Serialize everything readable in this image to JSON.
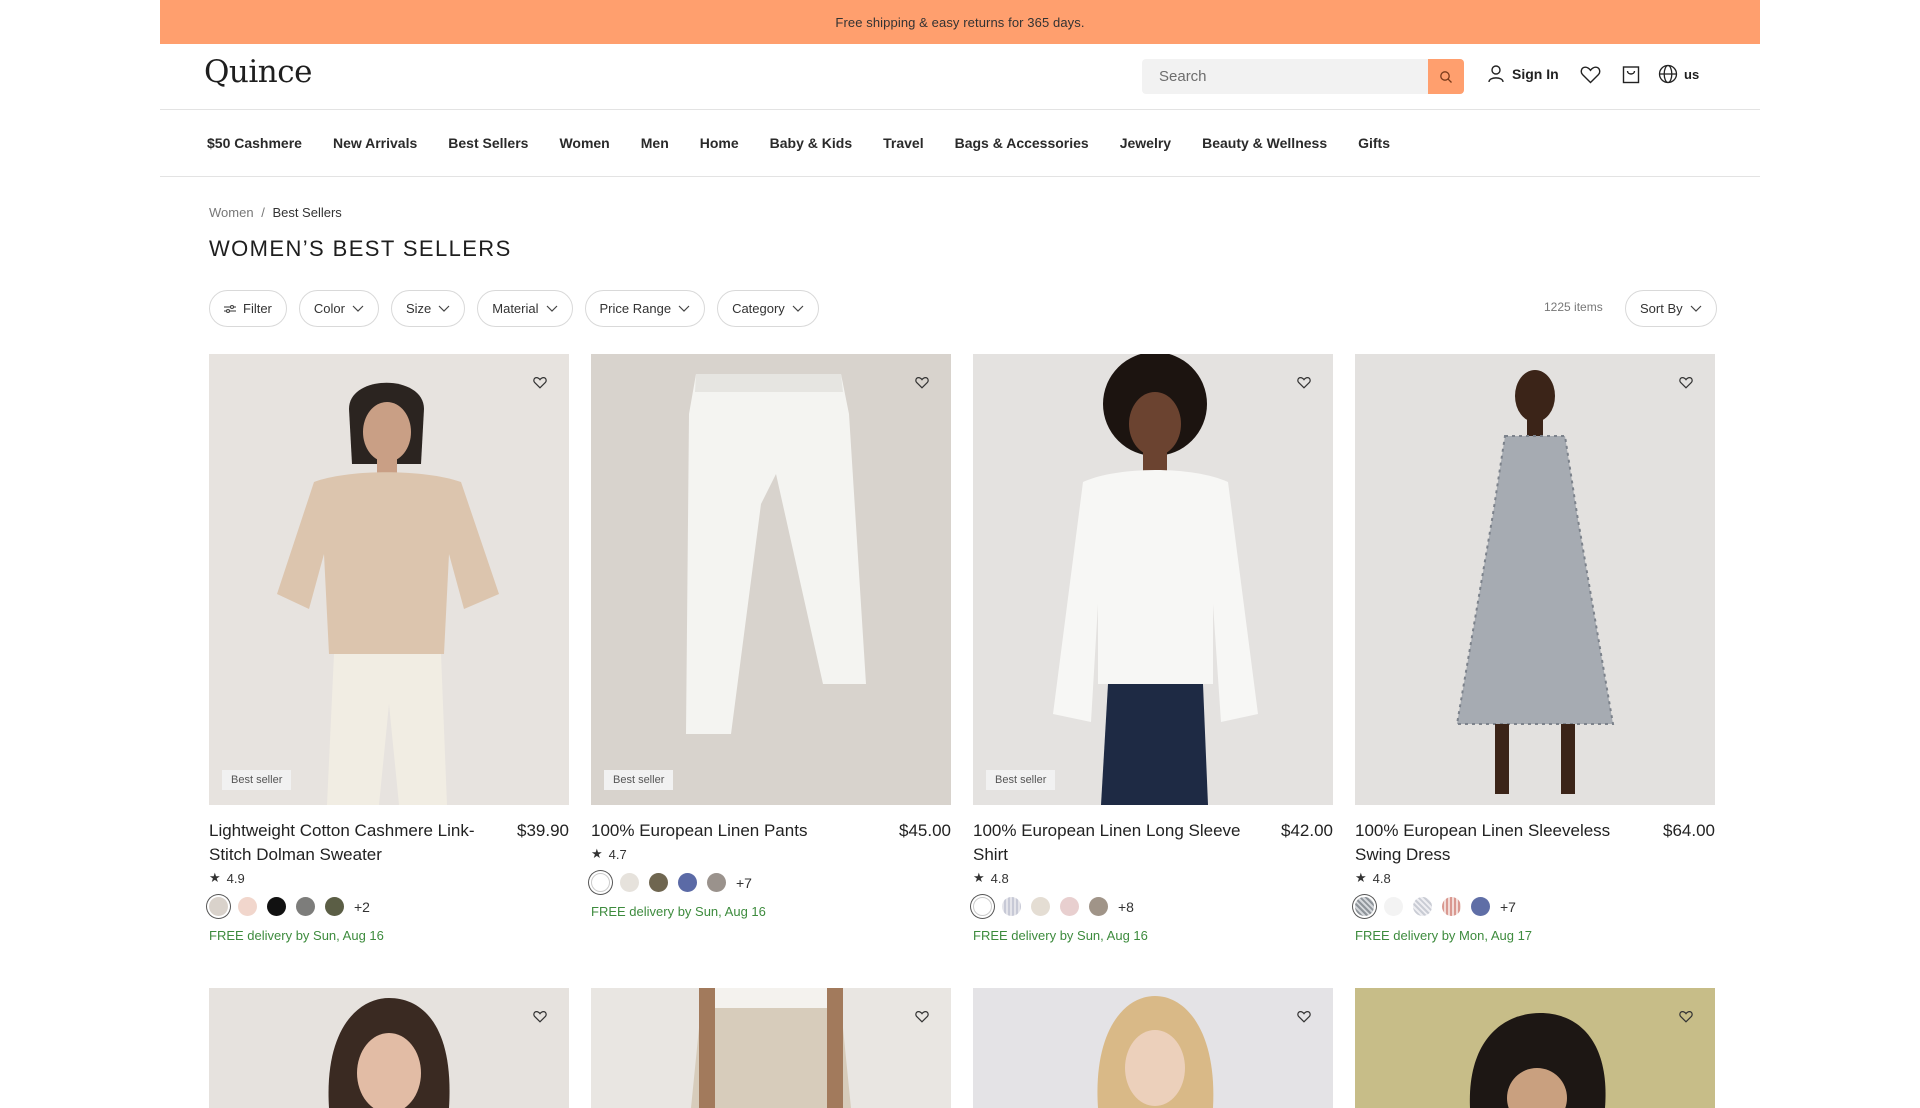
{
  "announcement": "Free shipping & easy returns for 365 days.",
  "header": {
    "logo": "Quince",
    "search_placeholder": "Search",
    "sign_in": "Sign In",
    "locale": "us"
  },
  "nav": [
    "$50 Cashmere",
    "New Arrivals",
    "Best Sellers",
    "Women",
    "Men",
    "Home",
    "Baby & Kids",
    "Travel",
    "Bags & Accessories",
    "Jewelry",
    "Beauty & Wellness",
    "Gifts"
  ],
  "breadcrumb": {
    "parent": "Women",
    "separator": "/",
    "current": "Best Sellers"
  },
  "page_title": "WOMEN’S BEST SELLERS",
  "filters": [
    "Filter",
    "Color",
    "Size",
    "Material",
    "Price Range",
    "Category"
  ],
  "item_count": "1225 items",
  "sort_label": "Sort By",
  "products": [
    {
      "name": "Lightweight Cotton Cashmere Link-Stitch Dolman Sweater",
      "price": "$39.90",
      "rating": "4.9",
      "badge": "Best seller",
      "swatches": [
        "#d9d2cb",
        "#f1d6cc",
        "#111111",
        "#7d7d7b",
        "#5b5e45"
      ],
      "more": "+2",
      "delivery": "FREE delivery by Sun, Aug 16",
      "image_bg": "#e7e3df"
    },
    {
      "name": "100% European Linen Pants",
      "price": "$45.00",
      "rating": "4.7",
      "badge": "Best seller",
      "swatches": [
        "#ffffff",
        "#e6e2dc",
        "#6f6650",
        "#5b6aa6",
        "#9a928c"
      ],
      "more": "+7",
      "delivery": "FREE delivery by Sun, Aug 16",
      "image_bg": "#d8d3cd"
    },
    {
      "name": "100% European Linen Long Sleeve Shirt",
      "price": "$42.00",
      "rating": "4.8",
      "badge": "Best seller",
      "swatches": [
        "#ffffff",
        "#e4e4ea",
        "#e4ddd3",
        "#e8cfcf",
        "#a09488"
      ],
      "more": "+8",
      "delivery": "FREE delivery by Sun, Aug 16",
      "image_bg": "#e4e2e0"
    },
    {
      "name": "100% European Linen Sleeveless Swing Dress",
      "price": "$64.00",
      "rating": "4.8",
      "badge": "",
      "swatches": [
        "#8e949a",
        "#f3f3f3",
        "#c9ccd4",
        "#d99890",
        "#5f6ea6"
      ],
      "more": "+7",
      "delivery": "FREE delivery by Mon, Aug 17",
      "image_bg": "#e3e1df"
    }
  ]
}
